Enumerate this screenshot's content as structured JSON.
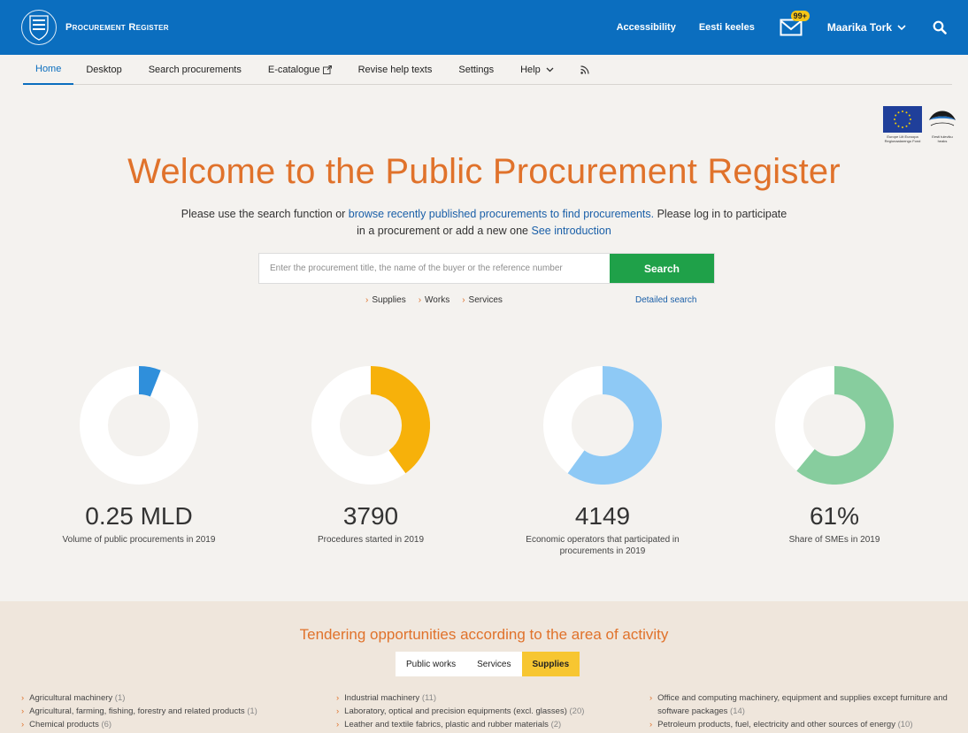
{
  "header": {
    "brand": "Procurement Register",
    "accessibility": "Accessibility",
    "language": "Eesti keeles",
    "mail_badge": "99+",
    "user_name": "Maarika Tork"
  },
  "nav": {
    "items": [
      "Home",
      "Desktop",
      "Search procurements",
      "E-catalogue",
      "Revise help texts",
      "Settings",
      "Help"
    ]
  },
  "eu": {
    "caption": "Europe Liit Euroopa Regionaalarengu Fond",
    "ee_caption": "Eesti tuleviku heaks"
  },
  "hero": {
    "title": "Welcome to the Public Procurement Register",
    "desc_1": "Please use the search function or ",
    "desc_link": "browse recently published procurements to find procurements.",
    "desc_2": " Please log in to participate in a procurement or add a new one ",
    "desc_link_2": "See introduction"
  },
  "search": {
    "placeholder": "Enter the procurement title, the name of the buyer or the reference number",
    "button": "Search",
    "categories": [
      "Supplies",
      "Works",
      "Services"
    ],
    "detailed": "Detailed search"
  },
  "stats": [
    {
      "value": "0.25 MLD",
      "label": "Volume of public procurements in 2019",
      "fraction": 0.06,
      "color": "#2f8fdb"
    },
    {
      "value": "3790",
      "label": "Procedures started in 2019",
      "fraction": 0.4,
      "color": "#f7b10a"
    },
    {
      "value": "4149",
      "label": "Economic operators that participated in procurements in 2019",
      "fraction": 0.6,
      "color": "#8ec9f5"
    },
    {
      "value": "61%",
      "label": "Share of SMEs in 2019",
      "fraction": 0.61,
      "color": "#87cd9e"
    }
  ],
  "tender": {
    "title": "Tendering opportunities according to the area of activity",
    "tabs": [
      "Public works",
      "Services",
      "Supplies"
    ],
    "active_tab": "Supplies",
    "col1": [
      {
        "name": "Agricultural machinery",
        "count": "(1)"
      },
      {
        "name": "Agricultural, farming, fishing, forestry and related products",
        "count": "(1)"
      },
      {
        "name": "Chemical products",
        "count": "(6)"
      }
    ],
    "col2": [
      {
        "name": "Industrial machinery",
        "count": "(11)"
      },
      {
        "name": "Laboratory, optical and precision equipments (excl. glasses)",
        "count": "(20)"
      },
      {
        "name": "Leather and textile fabrics, plastic and rubber materials",
        "count": "(2)"
      }
    ],
    "col3": [
      {
        "name": "Office and computing machinery, equipment and supplies except furniture and software packages",
        "count": "(14)"
      },
      {
        "name": "Petroleum products, fuel, electricity and other sources of energy",
        "count": "(10)"
      }
    ]
  }
}
